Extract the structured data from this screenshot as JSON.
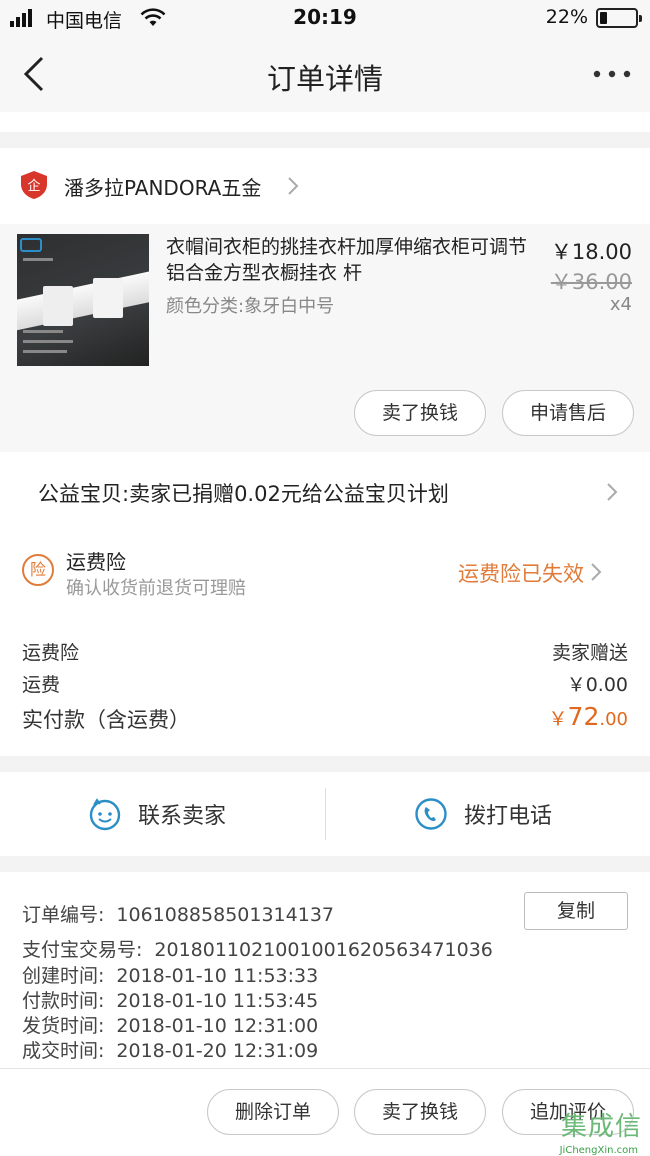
{
  "status_bar": {
    "carrier": "中国电信",
    "time": "20:19",
    "battery": "22%",
    "battery_level": 0.22
  },
  "nav": {
    "title": "订单详情",
    "back_icon": "chevron-left-icon",
    "more_icon": "more-dots-icon"
  },
  "shop": {
    "name": "潘多拉PANDORA五金",
    "icon": "enterprise-shield-icon",
    "icon_char": "企"
  },
  "product": {
    "name": "衣帽间衣柜的挑挂衣杆加厚伸缩衣柜可调节铝合金方型衣橱挂衣 杆",
    "sku": "颜色分类:象牙白中号",
    "price": "￥18.00",
    "original_price": "￥36.00",
    "quantity": "x4",
    "actions": {
      "resell": "卖了换钱",
      "after_sale": "申请售后"
    }
  },
  "charity": {
    "text": "公益宝贝:卖家已捐赠0.02元给公益宝贝计划"
  },
  "insurance": {
    "icon_char": "险",
    "title": "运费险",
    "subtitle": "确认收货前退货可理赔",
    "status": "运费险已失效"
  },
  "fees": {
    "insurance_label": "运费险",
    "insurance_value": "卖家赠送",
    "shipping_label": "运费",
    "shipping_value": "￥0.00",
    "total_label": "实付款（含运费）",
    "total_currency": "￥",
    "total_integer": "72",
    "total_decimal": ".00"
  },
  "contact": {
    "seller_label": "联系卖家",
    "phone_label": "拨打电话"
  },
  "order_info": {
    "order_no_label": "订单编号:",
    "order_no": "106108858501314137",
    "copy_label": "复制",
    "alipay_label": "支付宝交易号:",
    "alipay_no": "2018011021001001620563471036",
    "created_label": "创建时间:",
    "created": "2018-01-10 11:53:33",
    "paid_label": "付款时间:",
    "paid": "2018-01-10 11:53:45",
    "shipped_label": "发货时间:",
    "shipped": "2018-01-10 12:31:00",
    "completed_label": "成交时间:",
    "completed": "2018-01-20 12:31:09"
  },
  "bottom_actions": {
    "delete": "删除订单",
    "resell": "卖了换钱",
    "review": "追加评价"
  },
  "watermark": {
    "text": "集成信",
    "url": "JiChengXin.com"
  },
  "colors": {
    "accent_orange": "#e07b39",
    "total_orange": "#e0691f",
    "shop_red": "#d9362b",
    "icon_blue": "#2c8ec7"
  }
}
